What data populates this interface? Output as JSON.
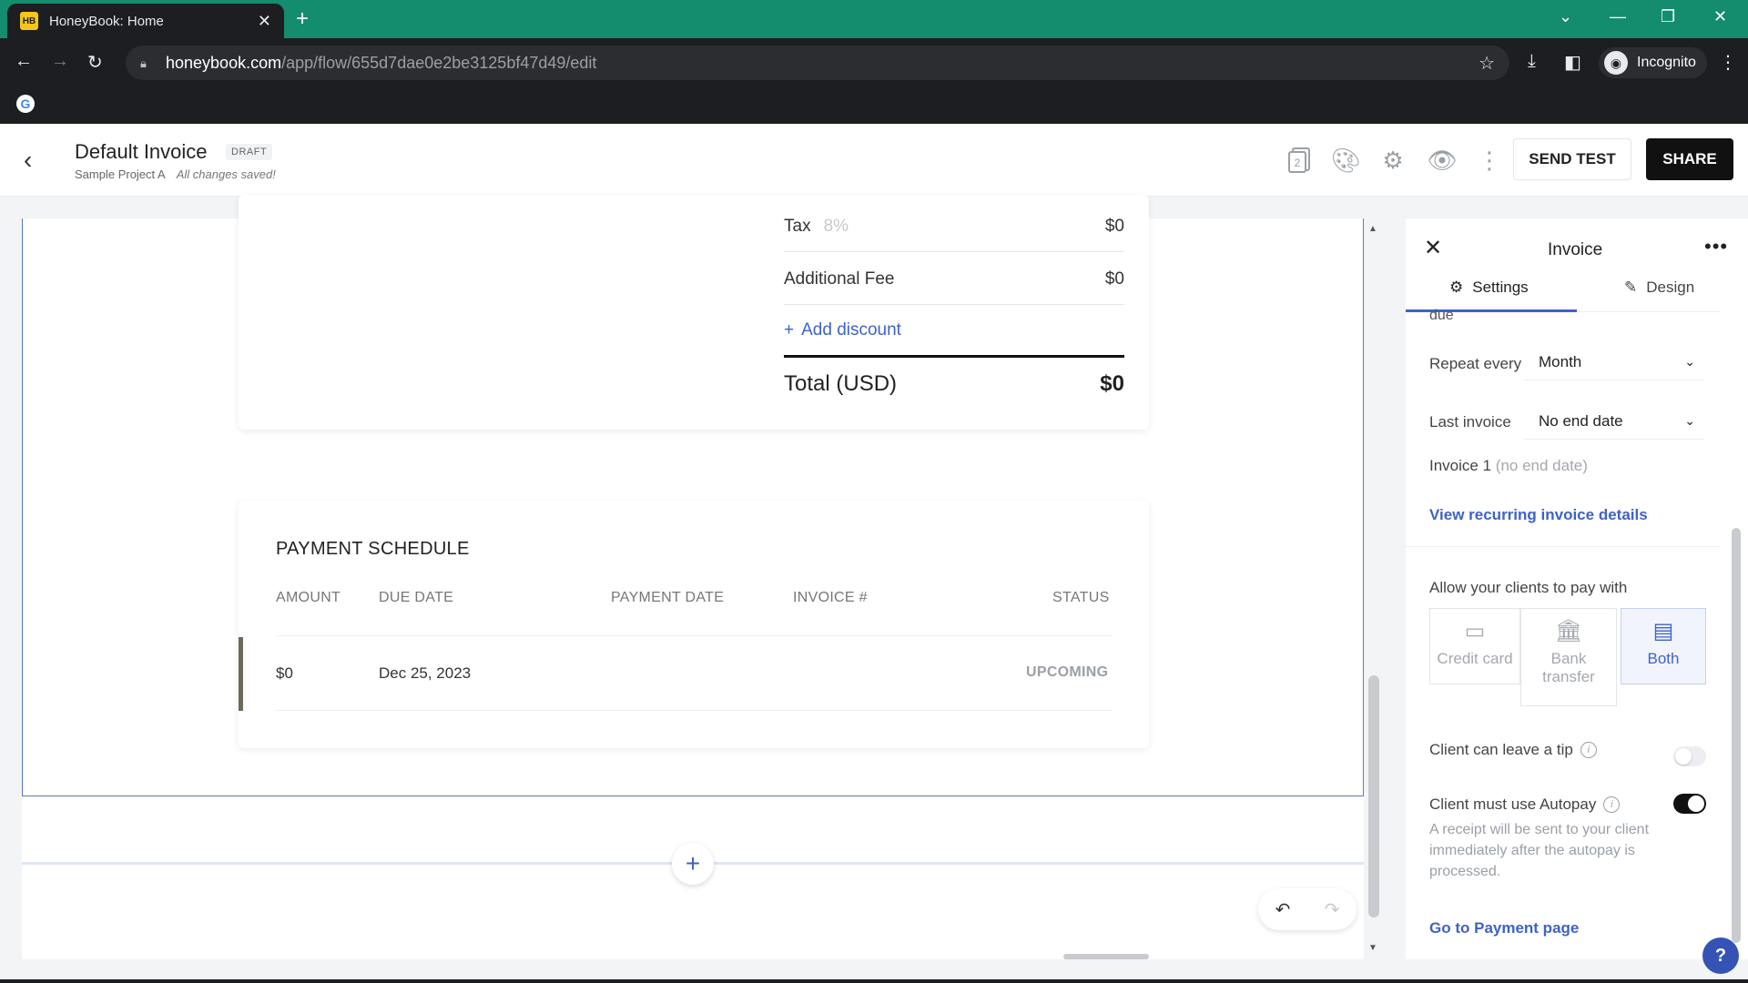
{
  "browser": {
    "tab_title": "HoneyBook: Home",
    "favicon_text": "HB",
    "url_host": "honeybook.com",
    "url_path": "/app/flow/655d7dae0e2be3125bf47d49/edit",
    "profile_label": "Incognito"
  },
  "header": {
    "title": "Default Invoice",
    "badge": "DRAFT",
    "project": "Sample Project A",
    "save_status": "All changes saved!",
    "page_count": "2",
    "send_test_label": "SEND TEST",
    "share_label": "SHARE"
  },
  "totals": {
    "tax_label": "Tax",
    "tax_rate": "8%",
    "tax_value": "$0",
    "fee_label": "Additional Fee",
    "fee_value": "$0",
    "add_discount_label": "Add discount",
    "total_label": "Total (USD)",
    "total_value": "$0"
  },
  "schedule": {
    "title": "PAYMENT SCHEDULE",
    "columns": [
      "AMOUNT",
      "DUE DATE",
      "PAYMENT DATE",
      "INVOICE #",
      "STATUS"
    ],
    "rows": [
      {
        "amount": "$0",
        "due_date": "Dec 25, 2023",
        "payment_date": "",
        "invoice": "",
        "status": "UPCOMING"
      }
    ]
  },
  "panel": {
    "title": "Invoice",
    "tabs": [
      {
        "label": "Settings",
        "icon": "gear-icon",
        "active": true
      },
      {
        "label": "Design",
        "icon": "pencil-icon",
        "active": false
      }
    ],
    "due_fragment": "due",
    "repeat_label": "Repeat every",
    "repeat_value": "Month",
    "last_label": "Last invoice",
    "last_value": "No end date",
    "invoice_note": "Invoice 1",
    "invoice_note_muted": "(no end date)",
    "view_details_link": "View recurring invoice details",
    "pay_with_label": "Allow your clients to pay with",
    "pay_options": [
      {
        "label": "Credit card",
        "icon": "credit-card-icon",
        "selected": false
      },
      {
        "label": "Bank transfer",
        "icon": "bank-icon",
        "selected": false
      },
      {
        "label": "Both",
        "icon": "card-and-bank-icon",
        "selected": true
      }
    ],
    "tip_label": "Client can leave a tip",
    "tip_enabled": false,
    "autopay_label": "Client must use Autopay",
    "autopay_enabled": true,
    "autopay_desc": "A receipt will be sent to your client immediately after the autopay is processed.",
    "payment_page_link": "Go to Payment page"
  },
  "colors": {
    "browser_frame": "#148c6e",
    "accent": "#3f62c7",
    "primary_button": "#111111"
  }
}
